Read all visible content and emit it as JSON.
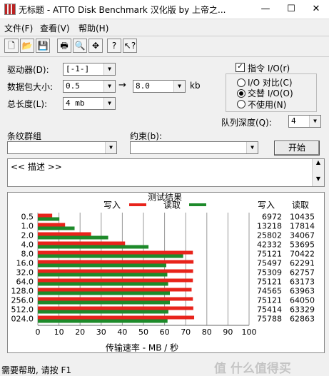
{
  "window": {
    "title": "无标题 - ATTO Disk Benchmark  汉化版 by 上帝之...",
    "min": "—",
    "max": "☐",
    "close": "✕"
  },
  "menu": [
    "文件(F)",
    "查看(V)",
    "帮助(H)"
  ],
  "settings": {
    "drive_label": "驱动器(D):",
    "drive_value": "[-1-]",
    "transfer_label": "数据包大小:",
    "transfer_from": "0.5",
    "transfer_arrow": "→",
    "transfer_to": "8.0",
    "transfer_unit": "kb",
    "length_label": "总长度(L):",
    "length_value": "4 mb",
    "direct_io_label": "指令 I/O(r)",
    "direct_io_checked": "✓",
    "io_compare_label": "I/O 对比(C)",
    "overlapped_io_label": "交替 I/O(O)",
    "neither_label": "不使用(N)",
    "queue_label": "队列深度(Q):",
    "queue_value": "4",
    "stripe_label": "条纹群组",
    "constraint_label": "约束(b):",
    "start_button": "开始",
    "description": "<< 描述 >>"
  },
  "chart_data": {
    "type": "bar",
    "title": "测试结果",
    "legend": {
      "write": "写入",
      "read": "读取",
      "write_color": "#e8231b",
      "read_color": "#1d8a2a"
    },
    "column_headers": {
      "write": "写入",
      "read": "读取"
    },
    "xlabel": "传输速率 - MB / 秒",
    "xlim": [
      0,
      100
    ],
    "xticks": [
      "0",
      "10",
      "20",
      "30",
      "40",
      "50",
      "60",
      "70",
      "80",
      "90",
      "100"
    ],
    "categories": [
      "0.5",
      "1.0",
      "2.0",
      "4.0",
      "8.0",
      "16.0",
      "32.0",
      "64.0",
      "128.0",
      "256.0",
      "512.0",
      "024.0"
    ],
    "write_values": [
      6972,
      13218,
      25802,
      42332,
      75121,
      75497,
      75309,
      75121,
      74565,
      75121,
      75414,
      75788
    ],
    "read_values": [
      10435,
      17814,
      34067,
      53695,
      70422,
      62291,
      62757,
      63173,
      63963,
      64050,
      63329,
      62863
    ],
    "write_bar_mbps": [
      6.8,
      12.9,
      25.2,
      41.3,
      73.4,
      73.7,
      73.5,
      73.4,
      72.8,
      73.4,
      73.6,
      74.0
    ],
    "read_bar_mbps": [
      10.2,
      17.4,
      33.3,
      52.4,
      68.8,
      60.8,
      61.3,
      61.7,
      62.5,
      62.5,
      61.8,
      61.4
    ]
  },
  "status": "需要帮助, 请按 F1",
  "watermark": "值 什么值得买"
}
